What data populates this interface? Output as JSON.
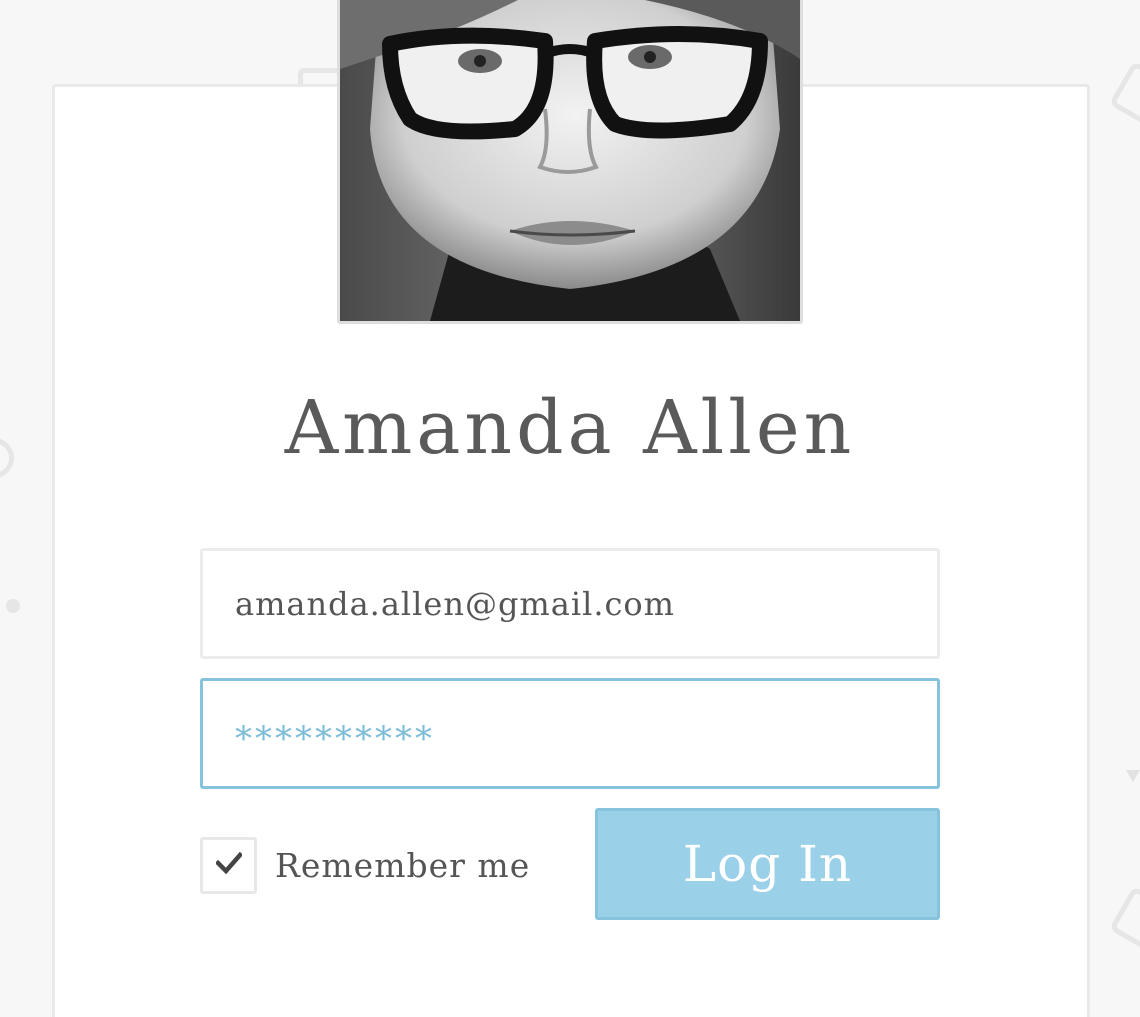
{
  "profile": {
    "name": "Amanda Allen"
  },
  "form": {
    "email_value": "amanda.allen@gmail.com",
    "password_value": "**********",
    "remember_label": "Remember me",
    "remember_checked": true,
    "login_label": "Log In"
  },
  "colors": {
    "accent": "#9bd1e8",
    "accent_border": "#86c4de",
    "text": "#5a5a5a"
  },
  "icons": {
    "checkbox": "check-icon"
  }
}
